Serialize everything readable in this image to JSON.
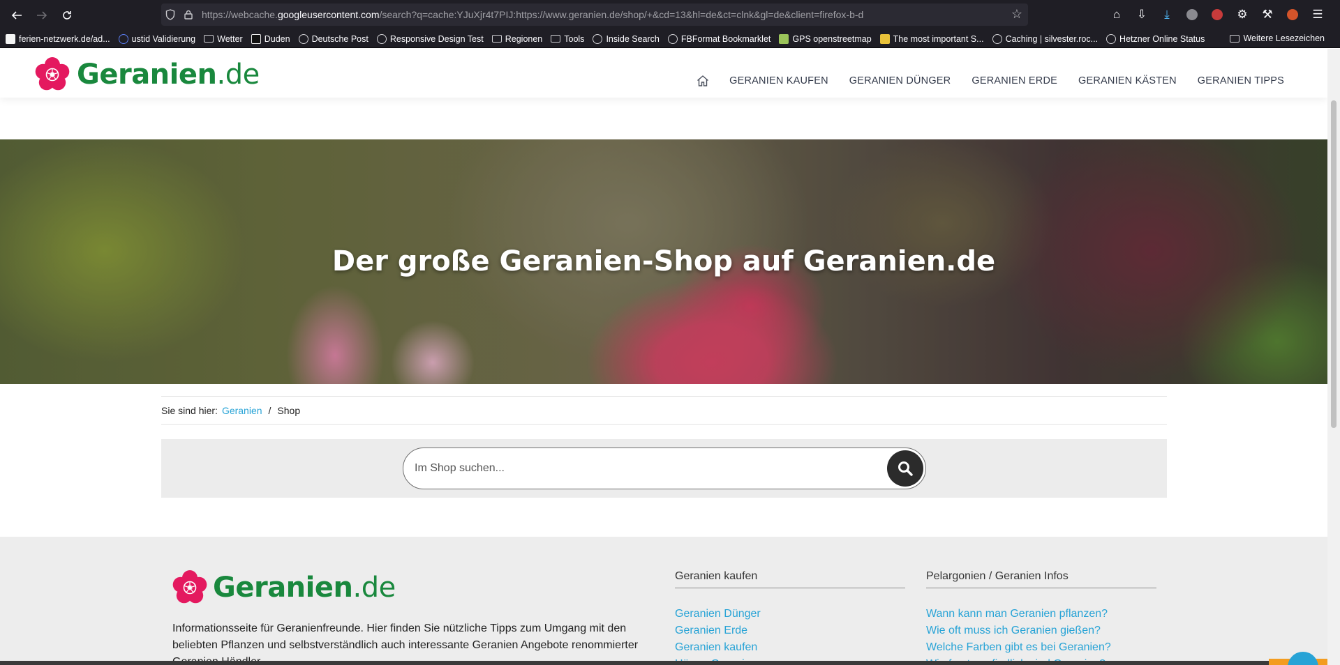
{
  "browser": {
    "url_prefix": "https://webcache.",
    "url_host": "googleusercontent.com",
    "url_rest": "/search?q=cache:YJuXjr4t7PIJ:https://www.geranien.de/shop/+&cd=13&hl=de&ct=clnk&gl=de&client=firefox-b-d",
    "bookmarks": [
      "ferien-netzwerk.de/ad...",
      "ustid Validierung",
      "Wetter",
      "Duden",
      "Deutsche Post",
      "Responsive Design Test",
      "Regionen",
      "Tools",
      "Inside Search",
      "FBFormat Bookmarklet",
      "GPS openstreetmap",
      "The most important S...",
      "Caching | silvester.roc...",
      "Hetzner Online Status"
    ],
    "other_bookmarks": "Weitere Lesezeichen"
  },
  "site": {
    "logo_name": "Geranien",
    "logo_tld": ".de",
    "brand_color": "#19883d",
    "accent_pink": "#e4195f",
    "link_color": "#27a3d6",
    "nav": [
      "GERANIEN KAUFEN",
      "GERANIEN DÜNGER",
      "GERANIEN ERDE",
      "GERANIEN KÄSTEN",
      "GERANIEN TIPPS"
    ]
  },
  "hero": {
    "title": "Der große Geranien-Shop auf Geranien.de"
  },
  "breadcrumb": {
    "label": "Sie sind hier:",
    "home": "Geranien",
    "sep": "/",
    "current": "Shop"
  },
  "search": {
    "placeholder": "Im Shop suchen..."
  },
  "footer": {
    "description": "Informationsseite für Geranienfreunde. Hier finden Sie nützliche Tipps zum Umgang mit den beliebten Pflanzen und selbstverständlich auch interessante Geranien Angebote renommierter Geranien Händler.",
    "col1": {
      "title": "Geranien kaufen",
      "links": [
        "Geranien Dünger",
        "Geranien Erde",
        "Geranien kaufen",
        "Hänge Geranien"
      ]
    },
    "col2": {
      "title": "Pelargonien / Geranien Infos",
      "links": [
        "Wann kann man Geranien pflanzen?",
        "Wie oft muss ich Geranien gießen?",
        "Welche Farben gibt es bei Geranien?",
        "Wie frostempfindlich sind Geranien?"
      ]
    }
  }
}
